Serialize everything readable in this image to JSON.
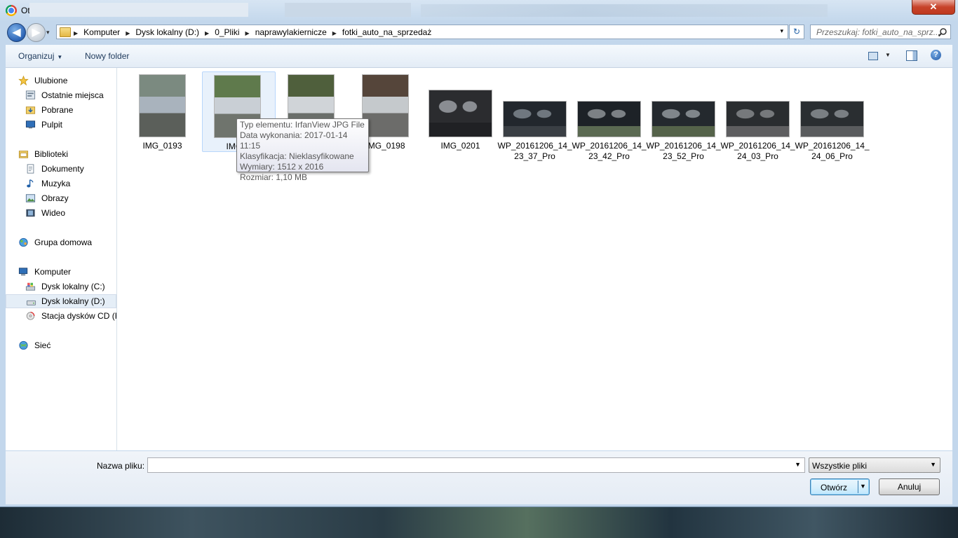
{
  "window": {
    "title": "Ot",
    "close_symbol": "✕"
  },
  "navigation": {
    "back_symbol": "◀",
    "forward_symbol": "▶",
    "dropdown_symbol": "▾",
    "breadcrumb": [
      "Komputer",
      "Dysk lokalny (D:)",
      "0_Pliki",
      "naprawylakiernicze",
      "fotki_auto_na_sprzedaż"
    ],
    "breadcrumb_separator": "▶",
    "refresh_symbol": "↻",
    "search_placeholder": "Przeszukaj: fotki_auto_na_sprz..."
  },
  "toolbar": {
    "organize_label": "Organizuj",
    "new_folder_label": "Nowy folder",
    "caret": "▼",
    "help_symbol": "?"
  },
  "sidebar": {
    "favorites": {
      "label": "Ulubione",
      "items": [
        "Ostatnie miejsca",
        "Pobrane",
        "Pulpit"
      ]
    },
    "libraries": {
      "label": "Biblioteki",
      "items": [
        "Dokumenty",
        "Muzyka",
        "Obrazy",
        "Wideo"
      ]
    },
    "homegroup": {
      "label": "Grupa domowa"
    },
    "computer": {
      "label": "Komputer",
      "items": [
        "Dysk lokalny (C:)",
        "Dysk lokalny (D:)",
        "Stacja dysków CD (F"
      ]
    },
    "network": {
      "label": "Sieć"
    }
  },
  "files": [
    {
      "name": "IMG_0193",
      "line2": "",
      "kind": "portrait",
      "colors": [
        "#7b8a80",
        "#a9b3bd",
        "#5b5f5a"
      ]
    },
    {
      "name": "IMG_0",
      "line2": "",
      "kind": "portrait",
      "colors": [
        "#5f7a4c",
        "#c9cfd5",
        "#6f746d"
      ]
    },
    {
      "name": "",
      "line2": "",
      "kind": "portrait",
      "colors": [
        "#4f5f3c",
        "#d0d4d8",
        "#6a6e6a"
      ]
    },
    {
      "name": "IMG_0198",
      "line2": "",
      "kind": "portrait",
      "colors": [
        "#55453a",
        "#c5c9cc",
        "#6c6c6a"
      ]
    },
    {
      "name": "IMG_0201",
      "line2": "",
      "kind": "landscape",
      "colors": [
        "#2b2c2f",
        "#8a8d92",
        "#202124"
      ]
    },
    {
      "name": "WP_20161206_14_",
      "line2": "23_37_Pro",
      "kind": "landscape",
      "colors": [
        "#22272d",
        "#6f777f",
        "#3a3f44"
      ]
    },
    {
      "name": "WP_20161206_14_",
      "line2": "23_42_Pro",
      "kind": "landscape",
      "colors": [
        "#1d2227",
        "#7c8185",
        "#5b6a52"
      ]
    },
    {
      "name": "WP_20161206_14_",
      "line2": "23_52_Pro",
      "kind": "landscape",
      "colors": [
        "#24292e",
        "#80868b",
        "#55634a"
      ]
    },
    {
      "name": "WP_20161206_14_",
      "line2": "24_03_Pro",
      "kind": "landscape",
      "colors": [
        "#2a2d30",
        "#76797c",
        "#5e5e60"
      ]
    },
    {
      "name": "WP_20161206_14_",
      "line2": "24_06_Pro",
      "kind": "landscape",
      "colors": [
        "#2a2e31",
        "#7a7f83",
        "#5a5c5e"
      ]
    }
  ],
  "tooltip": {
    "lines": [
      "Typ elementu: IrfanView JPG File",
      "Data wykonania: 2017-01-14 11:15",
      "Klasyfikacja: Nieklasyfikowane",
      "Wymiary: 1512 x 2016",
      "Rozmiar: 1,10 MB"
    ]
  },
  "footer": {
    "filename_label": "Nazwa pliku:",
    "filename_value": "",
    "filter_value": "Wszystkie pliki",
    "open_label": "Otwórz",
    "cancel_label": "Anuluj",
    "dropdown_symbol": "▼"
  }
}
